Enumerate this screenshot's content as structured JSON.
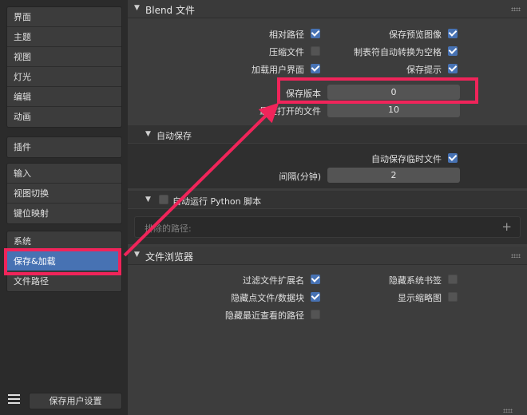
{
  "sidebar": {
    "groups": [
      [
        "界面",
        "主题",
        "视图",
        "灯光",
        "编辑",
        "动画"
      ],
      [
        "插件"
      ],
      [
        "输入",
        "视图切换",
        "键位映射"
      ],
      [
        "系统",
        "保存&加载",
        "文件路径"
      ]
    ],
    "active": "保存&加载",
    "save_button": "保存用户设置",
    "menu_icon": "hamburger-menu-icon"
  },
  "blend_panel": {
    "title": "Blend 文件",
    "relative_paths": {
      "label": "相对路径",
      "checked": true
    },
    "save_preview": {
      "label": "保存预览图像",
      "checked": true
    },
    "compress": {
      "label": "压缩文件",
      "checked": false
    },
    "tabs_as_spaces": {
      "label": "制表符自动转换为空格",
      "checked": true
    },
    "load_ui": {
      "label": "加载用户界面",
      "checked": true
    },
    "save_prompt": {
      "label": "保存提示",
      "checked": true
    },
    "save_versions": {
      "label": "保存版本",
      "value": "0"
    },
    "recent_files": {
      "label": "最近打开的文件",
      "value": "10"
    }
  },
  "autosave": {
    "title": "自动保存",
    "temp_files": {
      "label": "自动保存临时文件",
      "checked": true
    },
    "interval": {
      "label": "间隔(分钟)",
      "value": "2"
    }
  },
  "python": {
    "title": "自动运行 Python 脚本",
    "checked": false,
    "excluded_paths_placeholder": "排除的路径:"
  },
  "file_browser": {
    "title": "文件浏览器",
    "filter_ext": {
      "label": "过滤文件扩展名",
      "checked": true
    },
    "hide_bookmarks": {
      "label": "隐藏系统书签",
      "checked": false
    },
    "hide_dot": {
      "label": "隐藏点文件/数据块",
      "checked": true
    },
    "show_thumbnails": {
      "label": "显示缩略图",
      "checked": false
    },
    "hide_recent": {
      "label": "隐藏最近查看的路径",
      "checked": false
    }
  },
  "annotation": {
    "color": "#f0245a"
  }
}
